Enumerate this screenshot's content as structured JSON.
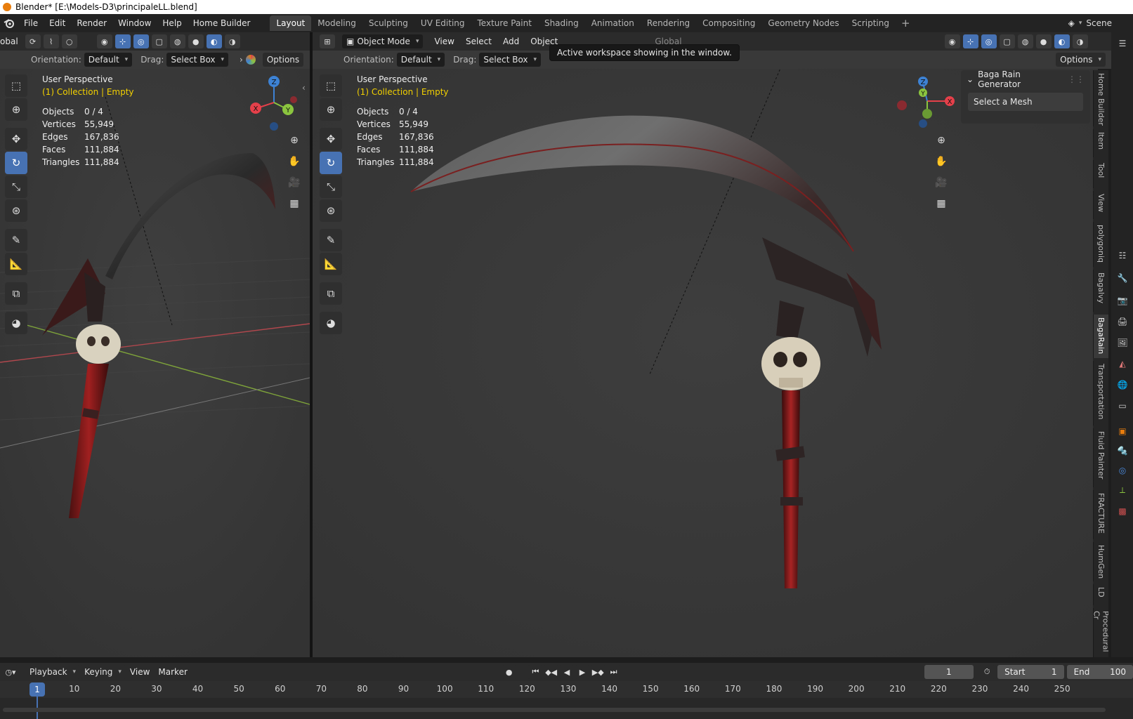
{
  "window": {
    "title": "Blender* [E:\\Models-D3\\principaleLL.blend]"
  },
  "menu": {
    "items": [
      "File",
      "Edit",
      "Render",
      "Window",
      "Help",
      "Home Builder"
    ]
  },
  "workspaces": {
    "active": "Layout",
    "tabs": [
      "Layout",
      "Modeling",
      "Sculpting",
      "UV Editing",
      "Texture Paint",
      "Shading",
      "Animation",
      "Rendering",
      "Compositing",
      "Geometry Nodes",
      "Scripting"
    ]
  },
  "scene": {
    "name": "Scene"
  },
  "left_header": {
    "global_partial": "obal"
  },
  "right_header": {
    "mode": "Object Mode",
    "menus": [
      "View",
      "Select",
      "Add",
      "Object"
    ],
    "global_partial": "Global"
  },
  "tool_settings": {
    "orientation_label": "Orientation:",
    "orientation_value": "Default",
    "drag_label": "Drag:",
    "drag_value": "Select Box",
    "options_label": "Options"
  },
  "tooltip": {
    "text": "Active workspace showing in the window."
  },
  "viewport_left": {
    "perspective": "User Perspective",
    "collection": "(1) Collection | Empty",
    "stats": [
      {
        "k": "Objects",
        "v": "0 / 4"
      },
      {
        "k": "Vertices",
        "v": "55,949"
      },
      {
        "k": "Edges",
        "v": "167,836"
      },
      {
        "k": "Faces",
        "v": "111,884"
      },
      {
        "k": "Triangles",
        "v": "111,884"
      }
    ]
  },
  "viewport_right": {
    "perspective": "User Perspective",
    "collection": "(1) Collection | Empty",
    "stats": [
      {
        "k": "Objects",
        "v": "0 / 4"
      },
      {
        "k": "Vertices",
        "v": "55,949"
      },
      {
        "k": "Edges",
        "v": "167,836"
      },
      {
        "k": "Faces",
        "v": "111,884"
      },
      {
        "k": "Triangles",
        "v": "111,884"
      }
    ]
  },
  "gizmo": {
    "x": "X",
    "y": "Y",
    "z": "Z"
  },
  "npanel": {
    "title": "Baga Rain Generator",
    "field": "Select a Mesh",
    "tabs": [
      "Home Builder",
      "Item",
      "Tool",
      "View",
      "polygoniq",
      "Bagalvy",
      "BagaRain",
      "Transportation",
      "Fluid Painter",
      "FRACTURE",
      "HumGen",
      "LD",
      "Procedural Cr"
    ],
    "active_tab": "BagaRain"
  },
  "timeline": {
    "menus": [
      "Playback",
      "Keying",
      "View",
      "Marker"
    ],
    "current_frame": "1",
    "start_label": "Start",
    "start_value": "1",
    "end_label": "End",
    "end_value": "100",
    "ruler": [
      "1",
      "10",
      "20",
      "30",
      "40",
      "50",
      "60",
      "70",
      "80",
      "90",
      "100",
      "110",
      "120",
      "130",
      "140",
      "150",
      "160",
      "170",
      "180",
      "190",
      "200",
      "210",
      "220",
      "230",
      "240",
      "250"
    ]
  },
  "colors": {
    "accent": "#4772b3",
    "collection_text": "#f2d000",
    "axis_x": "#e5404a",
    "axis_y": "#8bc53f",
    "axis_z": "#3d82d4",
    "blender_orange": "#e87d0d"
  }
}
